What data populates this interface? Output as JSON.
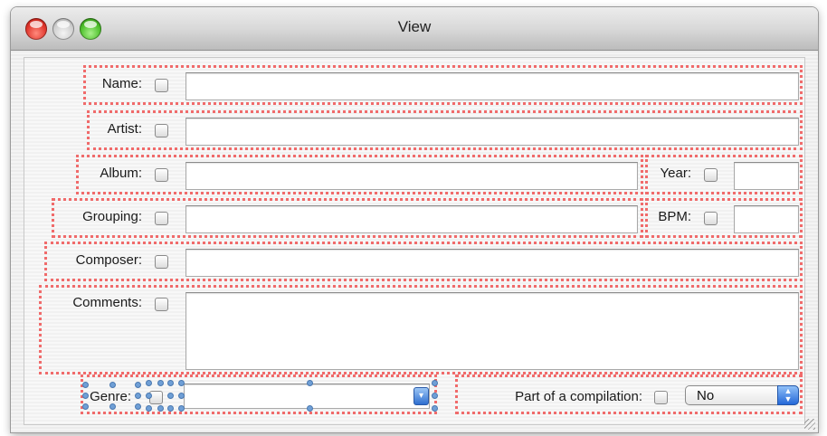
{
  "window": {
    "title": "View"
  },
  "fields": {
    "name": {
      "label": "Name:",
      "value": ""
    },
    "artist": {
      "label": "Artist:",
      "value": ""
    },
    "album": {
      "label": "Album:",
      "value": ""
    },
    "year": {
      "label": "Year:",
      "value": ""
    },
    "grouping": {
      "label": "Grouping:",
      "value": ""
    },
    "bpm": {
      "label": "BPM:",
      "value": ""
    },
    "composer": {
      "label": "Composer:",
      "value": ""
    },
    "comments": {
      "label": "Comments:",
      "value": ""
    },
    "genre": {
      "label": "Genre:",
      "value": ""
    },
    "compilation": {
      "label": "Part of a compilation:",
      "selected": "No"
    }
  },
  "colors": {
    "selection_outline": "#f06b6b",
    "handle": "#6f9fd6",
    "accent_blue": "#2468d8"
  },
  "icons": [
    "close-icon",
    "minimize-icon",
    "zoom-icon",
    "popup-arrows-icon",
    "combo-arrow-icon",
    "resize-grip-icon"
  ]
}
